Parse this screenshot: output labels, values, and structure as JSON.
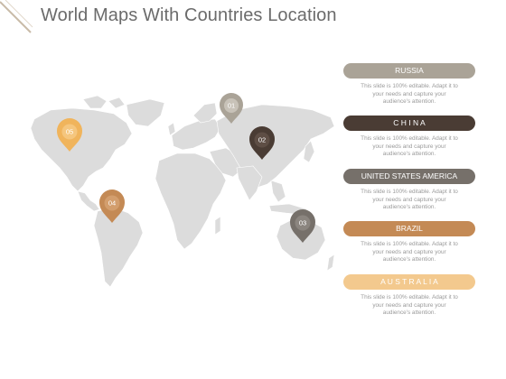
{
  "slide": {
    "title": "World Maps With Countries Location"
  },
  "colors": {
    "map_land": "#dcdcdc",
    "russia": "#aaa397",
    "china": "#4a3c34",
    "usa": "#76706a",
    "brazil": "#c48a55",
    "australia": "#f3c98e",
    "text_muted": "#9a9a9a"
  },
  "markers": [
    {
      "label": "01",
      "color": "#aaa397"
    },
    {
      "label": "02",
      "color": "#4a3c34"
    },
    {
      "label": "03",
      "color": "#76706a"
    },
    {
      "label": "04",
      "color": "#c48a55"
    },
    {
      "label": "05",
      "color": "#f0b45c"
    }
  ],
  "items": [
    {
      "name": "RUSSIA",
      "description": "This slide is 100% editable. Adapt it to\nyour needs and capture your\naudience's attention."
    },
    {
      "name": "C H I N A",
      "description": "This slide is 100% editable. Adapt it to\nyour needs and capture your\naudience's attention."
    },
    {
      "name": "UNITED STATES AMERICA",
      "description": "This slide is 100% editable. Adapt it to\nyour needs and capture your\naudience's attention."
    },
    {
      "name": "BRAZIL",
      "description": "This slide is 100% editable. Adapt it to\nyour needs and capture your\naudience's attention."
    },
    {
      "name": "A U S T R A L I A",
      "description": "This slide is 100% editable. Adapt it to\nyour needs and capture your\naudience's attention."
    }
  ]
}
